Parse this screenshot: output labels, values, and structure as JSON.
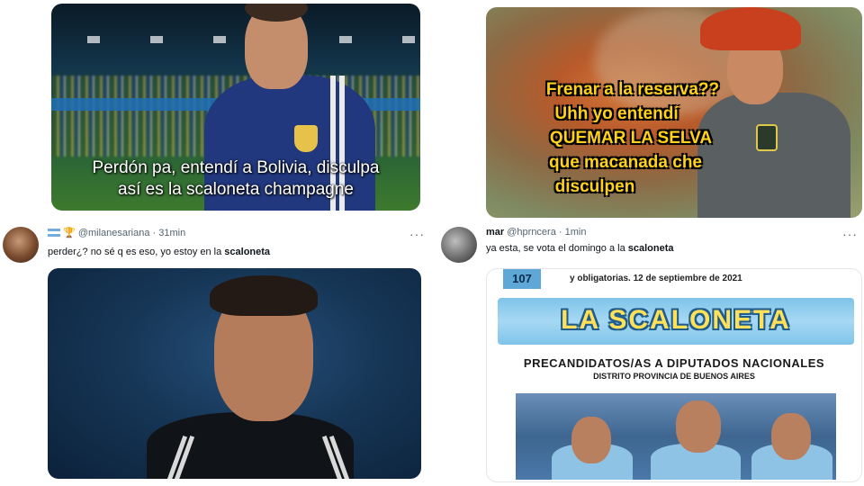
{
  "top_left_media": {
    "caption_line1": "Perdón pa, entendí a Bolivia, disculpa",
    "caption_line2": "así es la scaloneta champagne"
  },
  "top_right_media": {
    "caption_lines": [
      "Frenar a la reserva??",
      "Uhh yo entendí",
      "QUEMAR LA SELVA",
      "que macanada che",
      "disculpen"
    ]
  },
  "tweet_left": {
    "flag_icon": "argentina-flag",
    "trophy_icon": "trophy",
    "handle": "@milanesariana",
    "time": "· 31min",
    "text_before": "perder¿? no sé q es eso, yo estoy en la ",
    "text_highlight": "scaloneta",
    "more": "···"
  },
  "tweet_right": {
    "name": "mar",
    "handle": "@hprncera",
    "time": "· 1min",
    "text_before": "ya esta, se vota el domingo a la ",
    "text_highlight": "scaloneta",
    "more": "···"
  },
  "ballot": {
    "number": "107",
    "date_line": "y obligatorias. 12 de septiembre de 2021",
    "party": "LA SCALONETA",
    "heading": "PRECANDIDATOS/AS A DIPUTADOS NACIONALES",
    "district": "DISTRITO PROVINCIA DE BUENOS AIRES"
  }
}
